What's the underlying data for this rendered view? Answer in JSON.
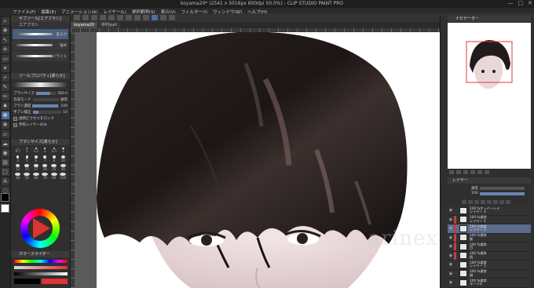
{
  "window": {
    "title": "koyama20* (2541 x 5016px 600dpi 50.0%) - CLIP STUDIO PAINT PRO",
    "buttons": [
      "—",
      "□",
      "✕"
    ]
  },
  "menu": {
    "items": [
      "ファイル(F)",
      "編集(E)",
      "アニメーション(A)",
      "レイヤー(L)",
      "選択範囲(S)",
      "表示(V)",
      "フィルター(I)",
      "ウィンドウ(W)",
      "ヘルプ(H)"
    ]
  },
  "left_panel": {
    "subtool_header": "サブツール[エアブラシ]",
    "subtool_group": "エアブラシ",
    "subtools": [
      {
        "label": "柔らか"
      },
      {
        "label": "強め"
      },
      {
        "label": "ハイライト"
      }
    ],
    "tool_property_header": "ツールプロパティ[柔らか]",
    "brush_size_label": "ブラシサイズ",
    "brush_size_value": "300.0",
    "props": [
      {
        "label": "合成モード",
        "value": "通常"
      },
      {
        "label": "ブラシ濃度",
        "value": "100"
      },
      {
        "label": "手ブレ補正",
        "value": "10"
      },
      {
        "label": "透明ピクセルをロック"
      },
      {
        "label": "参照レイヤーのみ"
      }
    ],
    "brush_size_header": "ブラシサイズ[柔らか]",
    "brush_sizes": [
      "0.7",
      "1",
      "1.5",
      "2",
      "2.5",
      "3",
      "4",
      "5",
      "6",
      "7",
      "8",
      "10",
      "12",
      "15",
      "17",
      "20",
      "25",
      "30",
      "40",
      "50",
      "60",
      "70",
      "80",
      "100"
    ],
    "color_slider_header": "カラースライダー"
  },
  "document_tabs": [
    {
      "label": "koyama20"
    },
    {
      "label": "中村yuri"
    }
  ],
  "canvas": {
    "watermark": "arinex"
  },
  "right_panel": {
    "navigator_header": "ナビゲーター",
    "layer_header": "レイヤー",
    "layer_mode": "通常",
    "layer_opacity": "100",
    "layers": [
      {
        "pct": "100 %オーバーレイ",
        "name": "レイヤー 3"
      },
      {
        "pct": "100 %通常",
        "name": "レイヤー 1"
      },
      {
        "pct": "100 %通常",
        "name": "レイヤー 2",
        "selected": true
      },
      {
        "pct": "100 %通常",
        "name": "髪"
      },
      {
        "pct": "100 %通常",
        "name": "目"
      },
      {
        "pct": "100 %通常",
        "name": "肌"
      },
      {
        "pct": "100 %通常",
        "name": "レイヤー 1"
      },
      {
        "pct": "100 %通常",
        "name": "顔"
      },
      {
        "pct": "100 %通常",
        "name": "ラーフル"
      },
      {
        "pct": "",
        "name": "用紙"
      }
    ]
  },
  "colors": {
    "accent": "#4a6fa5",
    "main_color": "#000000",
    "sub_color": "#ffffff"
  }
}
